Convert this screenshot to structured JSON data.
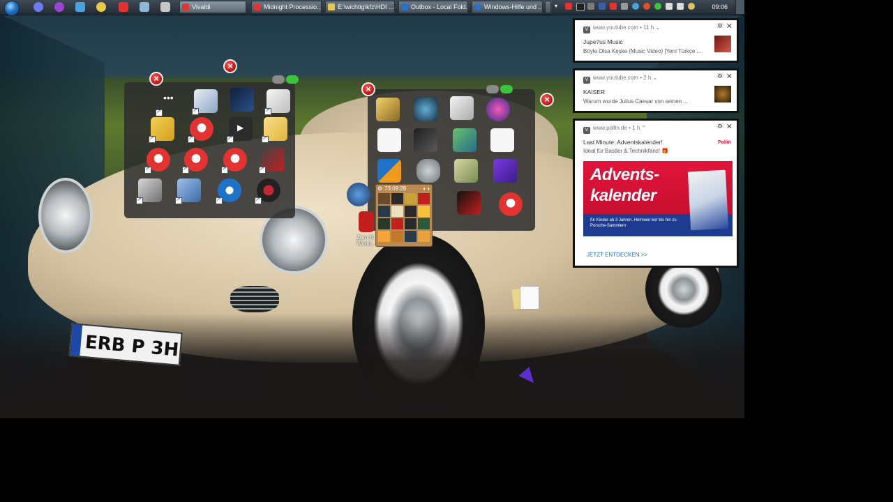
{
  "taskbar": {
    "start_label": "Start",
    "windows": [
      {
        "label": "Vivaldi",
        "active": true,
        "icon_color": "#e23232"
      },
      {
        "label": "Midnight Processio...",
        "icon_color": "#e23232"
      },
      {
        "label": "E:\\wichtig\\kfz\\HDI ...",
        "icon_color": "#e9c94a"
      },
      {
        "label": "Outbox - Local Fold...",
        "icon_color": "#2a6fcc"
      },
      {
        "label": "Windows-Hilfe und ...",
        "icon_color": "#2a6fcc"
      }
    ],
    "clock": "09:06"
  },
  "desktop": {
    "plate_text": "ERB P 3H",
    "zero_label_line1": "Zero H",
    "zero_label_line2": "World..."
  },
  "widget": {
    "time": "73:09:28"
  },
  "notifications": [
    {
      "source": "www.youtube.com",
      "age": "11 h",
      "title": "Jupe?us Music",
      "body": "Böyle Olsa Keşke (Music Video) [Yeni Türkçe ..."
    },
    {
      "source": "www.youtube.com",
      "age": "2 h",
      "title": "KAISER",
      "body": "Warum wurde Julius Caesar von seinen ..."
    },
    {
      "source": "www.pollin.de",
      "age": "1 h",
      "title": "Last Minute: Adventskalender!",
      "body": "Ideal für Bastler & Technikfans! 🎁",
      "ad": {
        "line1": "Advents-",
        "line2": "kalender",
        "sub": "für Kinder ab 3 Jahren, Heimwer-ker bis hin zu Porsche-Sammlern",
        "cta": "JETZT ENTDECKEN >>",
        "logo": "Pollin"
      }
    }
  ],
  "colors": {
    "accent_red": "#e23232",
    "notification_link": "#2a6fcc",
    "banner_red": "#e2153b"
  }
}
